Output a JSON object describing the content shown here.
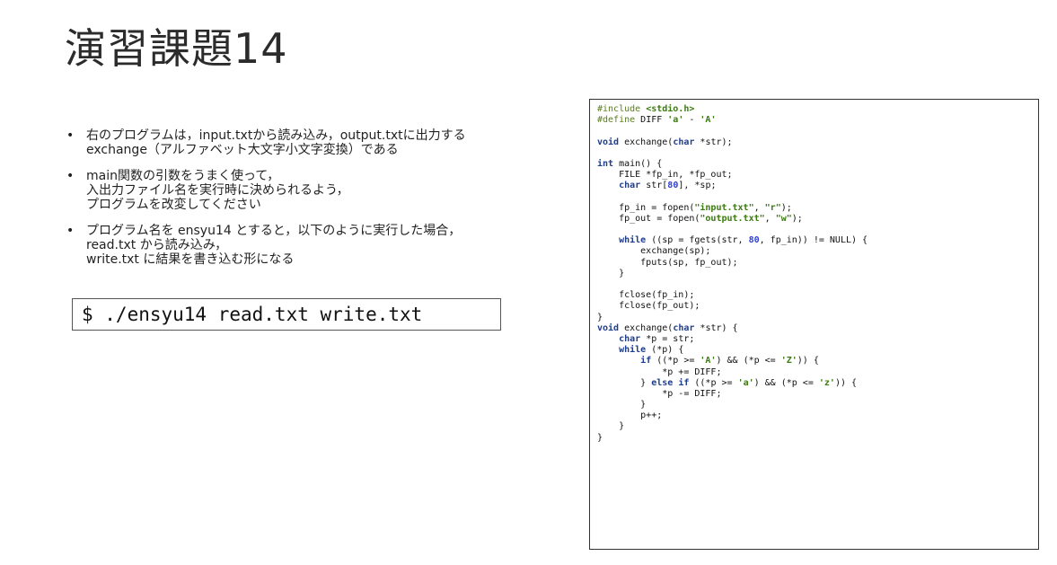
{
  "slide": {
    "title": "演習課題14",
    "bullets": [
      [
        "右のプログラムは，input.txtから読み込み，output.txtに出力する",
        "exchange（アルファベット大文字小文字変換）である"
      ],
      [
        "main関数の引数をうまく使って，",
        "入出力ファイル名を実行時に決められるよう，",
        "プログラムを改変してください"
      ],
      [
        "プログラム名を ensyu14 とすると，以下のように実行した場合，",
        "read.txt から読み込み，",
        "write.txt に結果を書き込む形になる"
      ]
    ],
    "command": "$ ./ensyu14 read.txt write.txt"
  },
  "code_lines": [
    [
      [
        "pp",
        "#include "
      ],
      [
        "str",
        "<stdio.h>"
      ]
    ],
    [
      [
        "pp",
        "#define "
      ],
      [
        "tok",
        "DIFF "
      ],
      [
        "str",
        "'a'"
      ],
      [
        "tok",
        " - "
      ],
      [
        "str",
        "'A'"
      ]
    ],
    [],
    [
      [
        "kw",
        "void"
      ],
      [
        "tok",
        " exchange("
      ],
      [
        "kw",
        "char"
      ],
      [
        "tok",
        " *str);"
      ]
    ],
    [],
    [
      [
        "kw",
        "int"
      ],
      [
        "tok",
        " main() {"
      ]
    ],
    [
      [
        "tok",
        "    FILE *fp_in, *fp_out;"
      ]
    ],
    [
      [
        "tok",
        "    "
      ],
      [
        "kw",
        "char"
      ],
      [
        "tok",
        " str["
      ],
      [
        "num",
        "80"
      ],
      [
        "tok",
        "], *sp;"
      ]
    ],
    [],
    [
      [
        "tok",
        "    fp_in = fopen("
      ],
      [
        "str",
        "\"input.txt\""
      ],
      [
        "tok",
        ", "
      ],
      [
        "str",
        "\"r\""
      ],
      [
        "tok",
        ");"
      ]
    ],
    [
      [
        "tok",
        "    fp_out = fopen("
      ],
      [
        "str",
        "\"output.txt\""
      ],
      [
        "tok",
        ", "
      ],
      [
        "str",
        "\"w\""
      ],
      [
        "tok",
        ");"
      ]
    ],
    [],
    [
      [
        "tok",
        "    "
      ],
      [
        "kw",
        "while"
      ],
      [
        "tok",
        " ((sp = fgets(str, "
      ],
      [
        "num",
        "80"
      ],
      [
        "tok",
        ", fp_in)) != NULL) {"
      ]
    ],
    [
      [
        "tok",
        "        exchange(sp);"
      ]
    ],
    [
      [
        "tok",
        "        fputs(sp, fp_out);"
      ]
    ],
    [
      [
        "tok",
        "    }"
      ]
    ],
    [],
    [
      [
        "tok",
        "    fclose(fp_in);"
      ]
    ],
    [
      [
        "tok",
        "    fclose(fp_out);"
      ]
    ],
    [
      [
        "tok",
        "}"
      ]
    ],
    [
      [
        "kw",
        "void"
      ],
      [
        "tok",
        " exchange("
      ],
      [
        "kw",
        "char"
      ],
      [
        "tok",
        " *str) {"
      ]
    ],
    [
      [
        "tok",
        "    "
      ],
      [
        "kw",
        "char"
      ],
      [
        "tok",
        " *p = str;"
      ]
    ],
    [
      [
        "tok",
        "    "
      ],
      [
        "kw",
        "while"
      ],
      [
        "tok",
        " (*p) {"
      ]
    ],
    [
      [
        "tok",
        "        "
      ],
      [
        "kw",
        "if"
      ],
      [
        "tok",
        " ((*p >= "
      ],
      [
        "str",
        "'A'"
      ],
      [
        "tok",
        ") && (*p <= "
      ],
      [
        "str",
        "'Z'"
      ],
      [
        "tok",
        ")) {"
      ]
    ],
    [
      [
        "tok",
        "            *p += DIFF;"
      ]
    ],
    [
      [
        "tok",
        "        } "
      ],
      [
        "kw",
        "else if"
      ],
      [
        "tok",
        " ((*p >= "
      ],
      [
        "str",
        "'a'"
      ],
      [
        "tok",
        ") && (*p <= "
      ],
      [
        "str",
        "'z'"
      ],
      [
        "tok",
        ")) {"
      ]
    ],
    [
      [
        "tok",
        "            *p -= DIFF;"
      ]
    ],
    [
      [
        "tok",
        "        }"
      ]
    ],
    [
      [
        "tok",
        "        p++;"
      ]
    ],
    [
      [
        "tok",
        "    }"
      ]
    ],
    [
      [
        "tok",
        "}"
      ]
    ]
  ]
}
